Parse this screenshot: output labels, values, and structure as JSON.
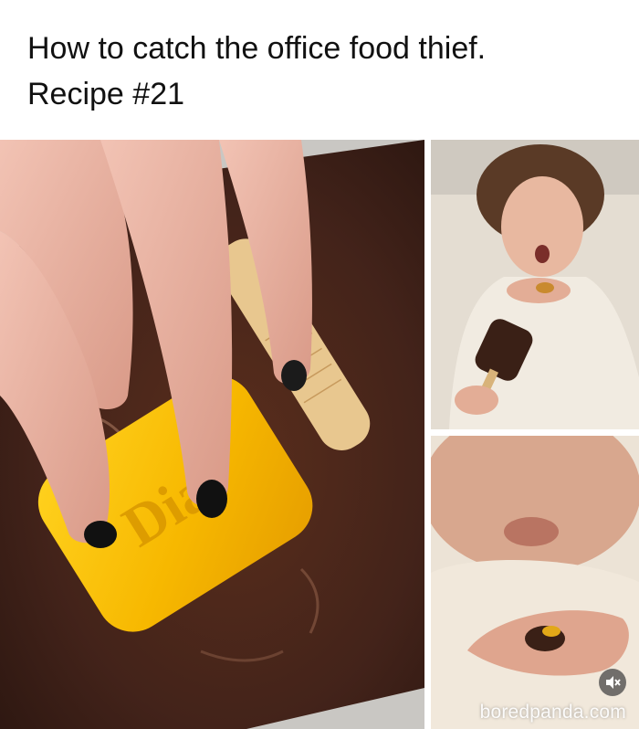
{
  "caption": {
    "line1": "How to catch the office food thief.",
    "line2": "Recipe #21"
  },
  "photos": {
    "left": {
      "soap_brand": "Dial"
    }
  },
  "watermark": "boredpanda.com",
  "icons": {
    "mute": "speaker-muted-icon"
  }
}
